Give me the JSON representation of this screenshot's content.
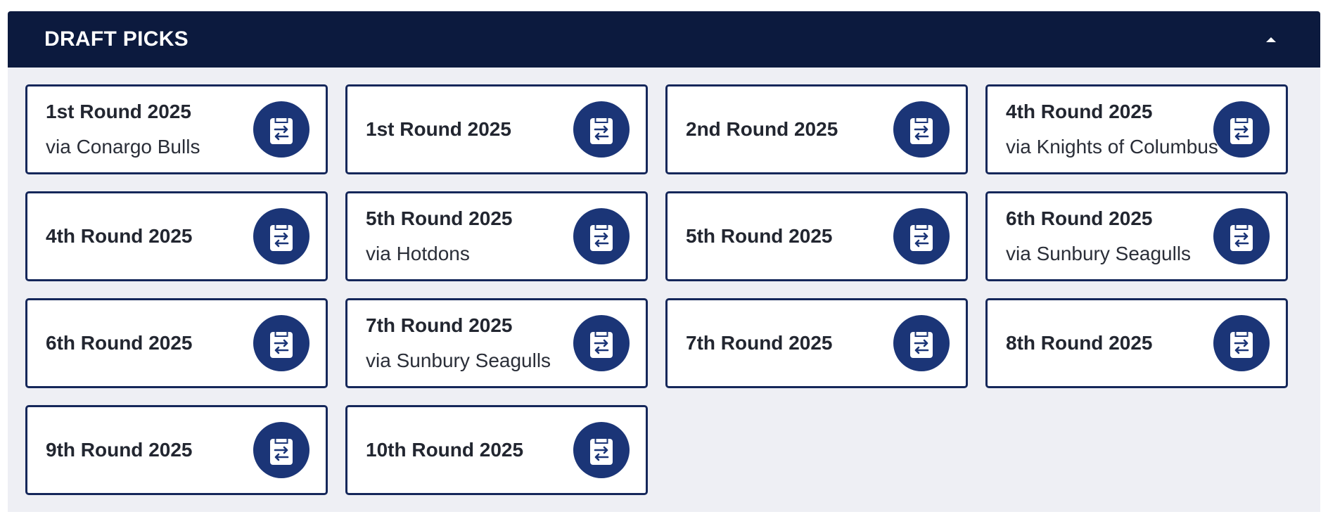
{
  "header": {
    "title": "DRAFT PICKS",
    "toggle_icon": "caret-up-icon"
  },
  "colors": {
    "header_bg": "#0c1a3e",
    "panel_bg": "#eeeff4",
    "card_border": "#15275a",
    "icon_circle": "#1b3577"
  },
  "picks": [
    {
      "title": "1st Round 2025",
      "via": "via Conargo Bulls",
      "icon": "clipboard-trade-icon"
    },
    {
      "title": "1st Round 2025",
      "via": "",
      "icon": "clipboard-trade-icon"
    },
    {
      "title": "2nd Round 2025",
      "via": "",
      "icon": "clipboard-trade-icon"
    },
    {
      "title": "4th Round 2025",
      "via": "via Knights of Columbus",
      "icon": "clipboard-trade-icon"
    },
    {
      "title": "4th Round 2025",
      "via": "",
      "icon": "clipboard-trade-icon"
    },
    {
      "title": "5th Round 2025",
      "via": "via Hotdons",
      "icon": "clipboard-trade-icon"
    },
    {
      "title": "5th Round 2025",
      "via": "",
      "icon": "clipboard-trade-icon"
    },
    {
      "title": "6th Round 2025",
      "via": "via Sunbury Seagulls",
      "icon": "clipboard-trade-icon"
    },
    {
      "title": "6th Round 2025",
      "via": "",
      "icon": "clipboard-trade-icon"
    },
    {
      "title": "7th Round 2025",
      "via": "via Sunbury Seagulls",
      "icon": "clipboard-trade-icon"
    },
    {
      "title": "7th Round 2025",
      "via": "",
      "icon": "clipboard-trade-icon"
    },
    {
      "title": "8th Round 2025",
      "via": "",
      "icon": "clipboard-trade-icon"
    },
    {
      "title": "9th Round 2025",
      "via": "",
      "icon": "clipboard-trade-icon"
    },
    {
      "title": "10th Round 2025",
      "via": "",
      "icon": "clipboard-trade-icon"
    }
  ]
}
